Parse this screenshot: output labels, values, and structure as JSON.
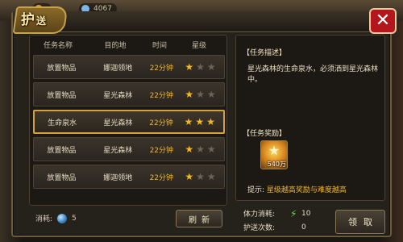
{
  "hud": {
    "currency_1": "",
    "currency_2": "4067"
  },
  "panel": {
    "title_main": "护",
    "title_sub": "送"
  },
  "list": {
    "headers": [
      "任务名称",
      "目的地",
      "时间",
      "星级"
    ],
    "rows": [
      {
        "name": "放置物品",
        "dest": "娜迦领地",
        "time": "22分钟",
        "stars": 1
      },
      {
        "name": "放置物品",
        "dest": "星光森林",
        "time": "22分钟",
        "stars": 1
      },
      {
        "name": "生命泉水",
        "dest": "星光森林",
        "time": "22分钟",
        "stars": 3,
        "selected": true
      },
      {
        "name": "放置物品",
        "dest": "星光森林",
        "time": "22分钟",
        "stars": 1
      },
      {
        "name": "放置物品",
        "dest": "娜迦领地",
        "time": "22分钟",
        "stars": 1
      }
    ],
    "max_stars": 3,
    "cost_label": "消耗:",
    "cost_value": "5",
    "refresh_label": "刷新"
  },
  "detail": {
    "desc_label": "【任务描述】",
    "desc_text": "星光森林的生命泉水，必须洒到星光森林中。",
    "reward_label": "【任务奖励】",
    "reward_amount": "540万",
    "hint_label": "提示:",
    "hint_text": "星级越高奖励与难度越高"
  },
  "stats": {
    "stamina_label": "体力消耗:",
    "stamina_value": "10",
    "escort_label": "护送次数:",
    "escort_value": "0"
  },
  "actions": {
    "claim_label": "领取"
  },
  "colors": {
    "accent": "#f2b62c",
    "close": "#b3171d",
    "selected_border": "#d8a23a"
  }
}
